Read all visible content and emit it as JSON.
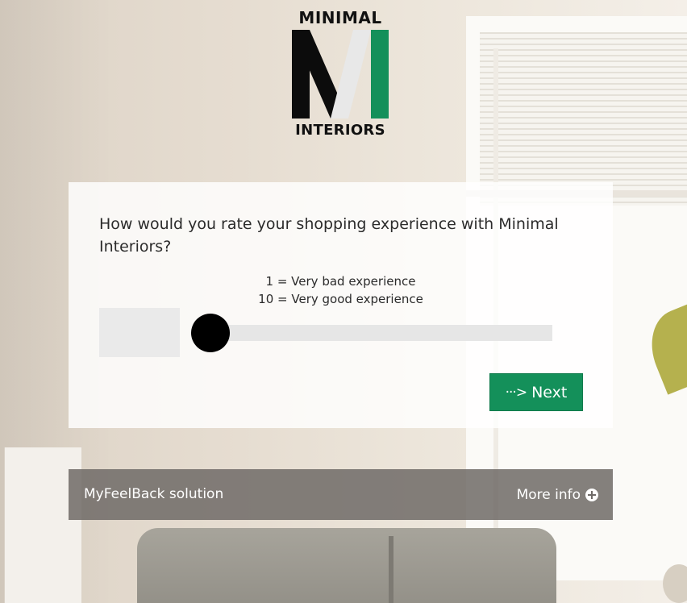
{
  "brand": {
    "logo_top_text": "MINIMAL",
    "logo_bottom_text": "INTERIORS",
    "colors": {
      "green": "#14905a",
      "black": "#111111"
    }
  },
  "survey": {
    "question": "How would you rate your shopping experience with Minimal Interiors?",
    "scale_min_label": "1 = Very bad experience",
    "scale_max_label": "10 = Very good experience",
    "slider": {
      "min": 1,
      "max": 10,
      "current_value": ""
    },
    "next_label": "Next",
    "next_icon": "dotted-arrow-right-icon"
  },
  "footer": {
    "solution_label": "MyFeelBack solution",
    "more_info_label": "More info",
    "more_info_icon": "plus-circle-icon"
  }
}
